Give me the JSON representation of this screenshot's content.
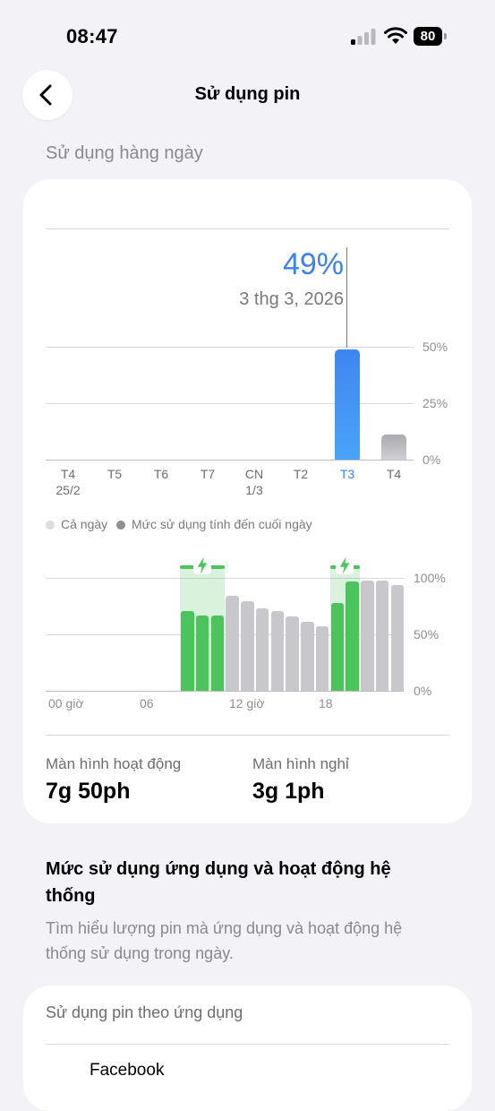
{
  "status": {
    "time": "08:47",
    "battery": "80"
  },
  "nav": {
    "title": "Sử dụng pin"
  },
  "daily": {
    "section_title": "Sử dụng hàng ngày",
    "selected_value": "49%",
    "selected_date": "3 thg 3, 2026",
    "y_ticks": [
      "50%",
      "25%",
      "0%"
    ],
    "legend": {
      "all_day": "Cả ngày",
      "end_of_day": "Mức sử dụng tính đến cuối ngày"
    }
  },
  "hourly": {
    "y_ticks": [
      "100%",
      "50%",
      "0%"
    ],
    "x_ticks": [
      "00 giờ",
      "06",
      "12 giờ",
      "18"
    ]
  },
  "stats": {
    "active_label": "Màn hình hoạt động",
    "active_value": "7g 50ph",
    "idle_label": "Màn hình nghỉ",
    "idle_value": "3g 1ph"
  },
  "apps": {
    "heading": "Mức sử dụng ứng dụng và hoạt động hệ thống",
    "description": "Tìm hiểu lượng pin mà ứng dụng và hoạt động hệ thống sử dụng trong ngày.",
    "card_title": "Sử dụng pin theo ứng dụng",
    "first_app": "Facebook"
  },
  "colors": {
    "accent_blue": "#3b82f0",
    "charge_green": "#4cc35c",
    "bar_gray": "#c7c7cc"
  },
  "icons": [
    "chevron-left-icon",
    "signal-icon",
    "wifi-icon",
    "battery-icon",
    "bolt-icon"
  ],
  "chart_data": [
    {
      "type": "bar",
      "categories": [
        "T4 25/2",
        "T5",
        "T6",
        "T7",
        "CN 1/3",
        "T2",
        "T3",
        "T4"
      ],
      "values": [
        0,
        0,
        0,
        0,
        0,
        0,
        49,
        11
      ],
      "selected_category": "T3",
      "ylim": [
        0,
        50
      ],
      "y_ticks": [
        "50%",
        "25%",
        "0%"
      ],
      "grid": true,
      "legend": "bottom"
    },
    {
      "type": "bar",
      "x_ticks": [
        "00 giờ",
        "06",
        "12 giờ",
        "18"
      ],
      "values": [
        null,
        null,
        null,
        null,
        null,
        null,
        null,
        null,
        null,
        71,
        67,
        67,
        84,
        79,
        73,
        71,
        66,
        61,
        57,
        78,
        97,
        98,
        98,
        94
      ],
      "charging": [
        false,
        false,
        false,
        false,
        false,
        false,
        false,
        false,
        false,
        true,
        true,
        true,
        false,
        false,
        false,
        false,
        false,
        false,
        false,
        true,
        true,
        false,
        false,
        false
      ],
      "ylim": [
        0,
        100
      ],
      "y_ticks": [
        "100%",
        "50%",
        "0%"
      ],
      "grid": true
    }
  ]
}
